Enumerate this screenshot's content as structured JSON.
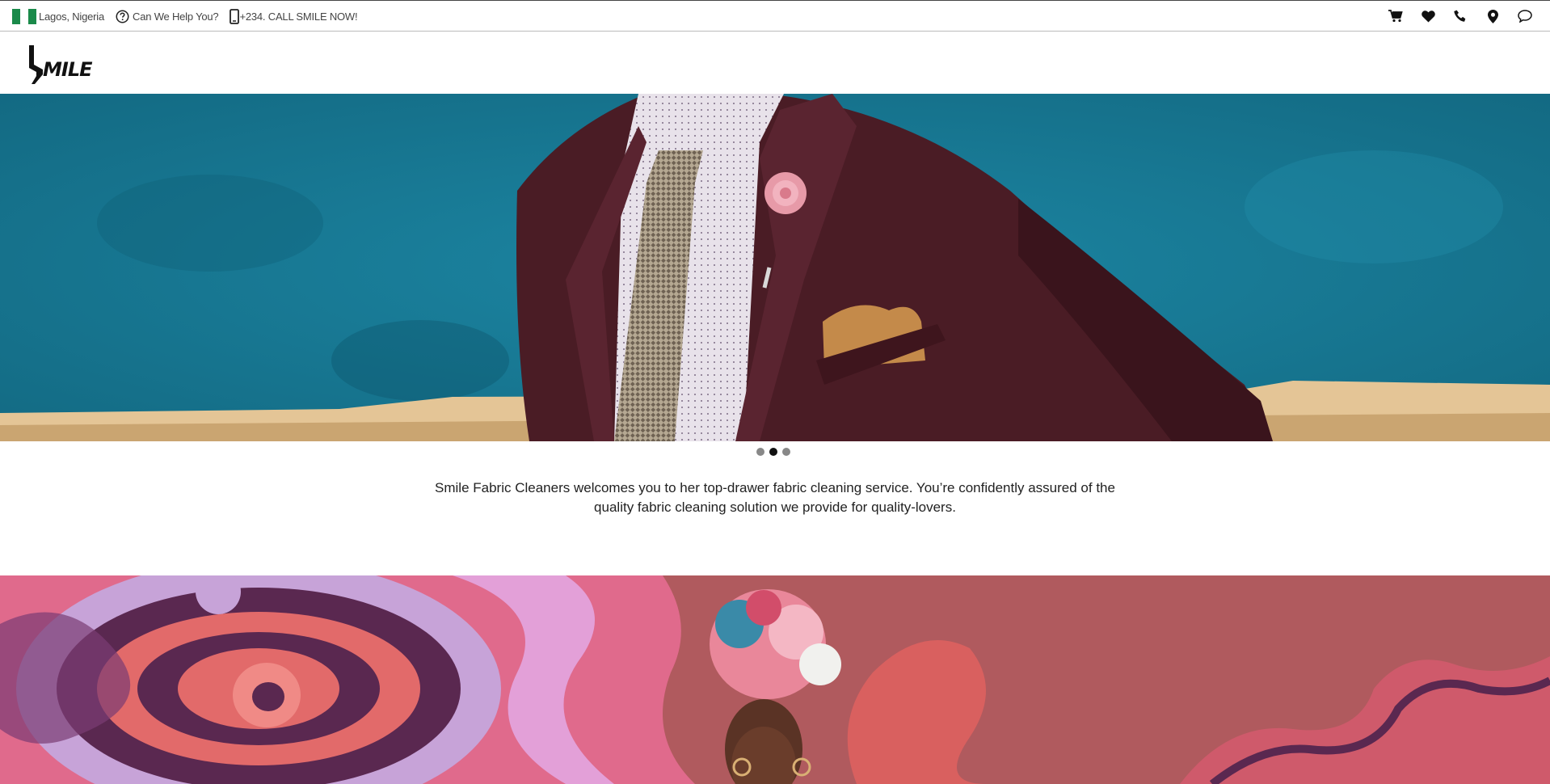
{
  "topbar": {
    "location": "Lagos, Nigeria",
    "help": "Can We Help You?",
    "phone": "+234. CALL SMILE NOW!",
    "flag_colors": [
      "#1a8a4a",
      "#ffffff",
      "#1a8a4a"
    ],
    "icons": [
      "cart-icon",
      "heart-icon",
      "phone-icon",
      "location-pin-icon",
      "chat-icon"
    ]
  },
  "header": {
    "logo_text": "MILE"
  },
  "hero": {
    "slides": 3,
    "active_slide": 2,
    "colors": {
      "wall": "#1b7c98",
      "suit": "#4a1c25",
      "ledge": "#e6c79a"
    }
  },
  "intro": {
    "text": "Smile Fabric Cleaners welcomes you to her top-drawer fabric cleaning service. You’re confidently assured of the quality fabric cleaning solution we provide for quality-lovers."
  },
  "banner": {
    "colors": {
      "bg": "#b05a5e",
      "swirl_pink": "#e06a8c",
      "swirl_purple": "#5a2850",
      "swirl_lilac": "#c7a3d8"
    }
  }
}
